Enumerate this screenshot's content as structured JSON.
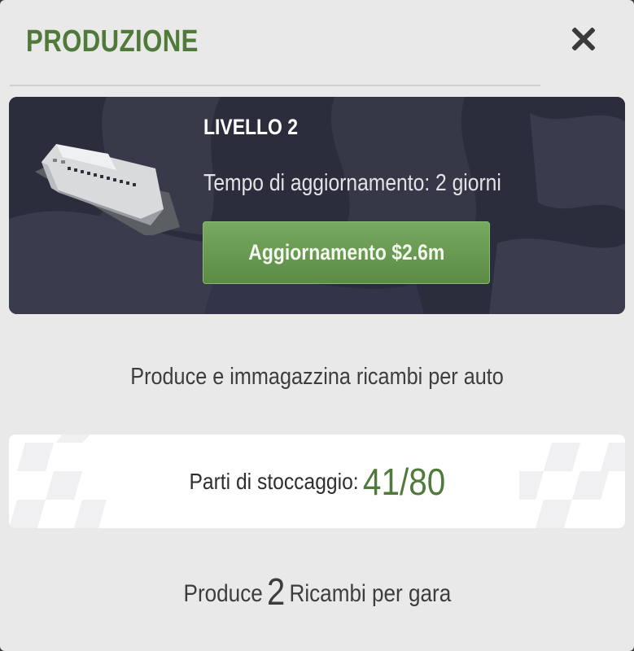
{
  "header": {
    "title": "PRODUZIONE",
    "close_icon": "close-icon"
  },
  "level_card": {
    "level_label": "LIVELLO 2",
    "upgrade_time": "Tempo di aggiornamento: 2 giorni",
    "upgrade_button_label": "Aggiornamento $2.6m",
    "image_icon": "factory-building-icon"
  },
  "description": "Produce e immagazzina ricambi per auto",
  "storage": {
    "label": "Parti di stoccaggio:",
    "value": "41/80"
  },
  "per_race": {
    "prefix": "Produce",
    "count": "2",
    "suffix": "Ricambi per gara"
  },
  "colors": {
    "accent_green": "#4f7a3a",
    "button_green": "#6a9a52",
    "card_dark": "#2e2f3e",
    "panel_bg": "#e9e9ea"
  }
}
